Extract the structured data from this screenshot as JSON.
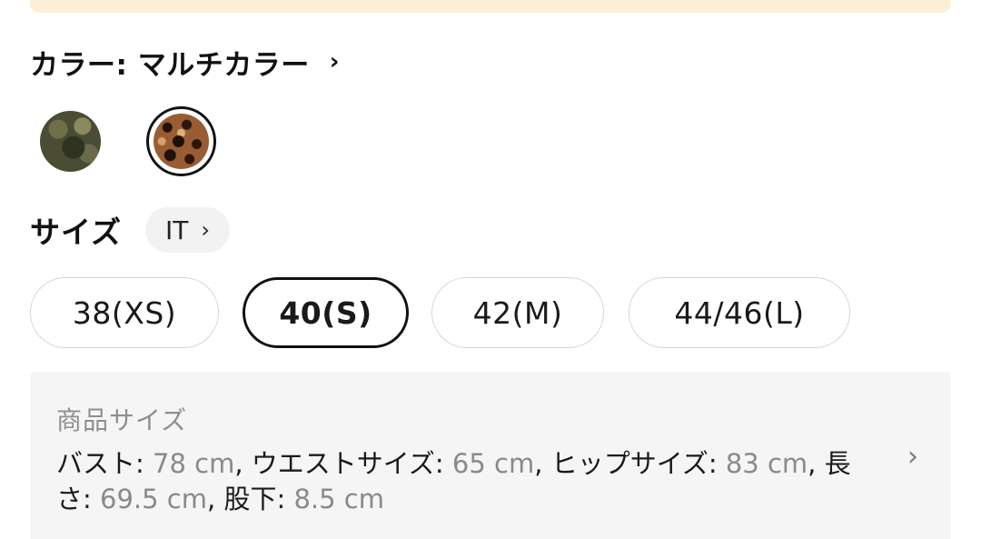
{
  "color": {
    "label": "カラー: マルチカラー",
    "chevron": "›",
    "swatches": [
      {
        "name": "camouflage",
        "selected": false
      },
      {
        "name": "leopard",
        "selected": true
      }
    ]
  },
  "size": {
    "label": "サイズ",
    "region": "IT",
    "region_chevron": "›",
    "options": [
      "38(XS)",
      "40(S)",
      "42(M)",
      "44/46(L)"
    ],
    "selected": "40(S)"
  },
  "product_size": {
    "title": "商品サイズ",
    "measurements": [
      {
        "label": "バスト",
        "value": "78 cm"
      },
      {
        "label": "ウエストサイズ",
        "value": "65 cm"
      },
      {
        "label": "ヒップサイズ",
        "value": "83 cm"
      },
      {
        "label": "長さ",
        "value": "69.5 cm"
      },
      {
        "label": "股下",
        "value": "8.5 cm"
      }
    ],
    "chevron": "›"
  },
  "colors": {
    "banner": "#fbf0d6",
    "selected_border": "#111111",
    "card_bg": "#f5f5f5"
  }
}
